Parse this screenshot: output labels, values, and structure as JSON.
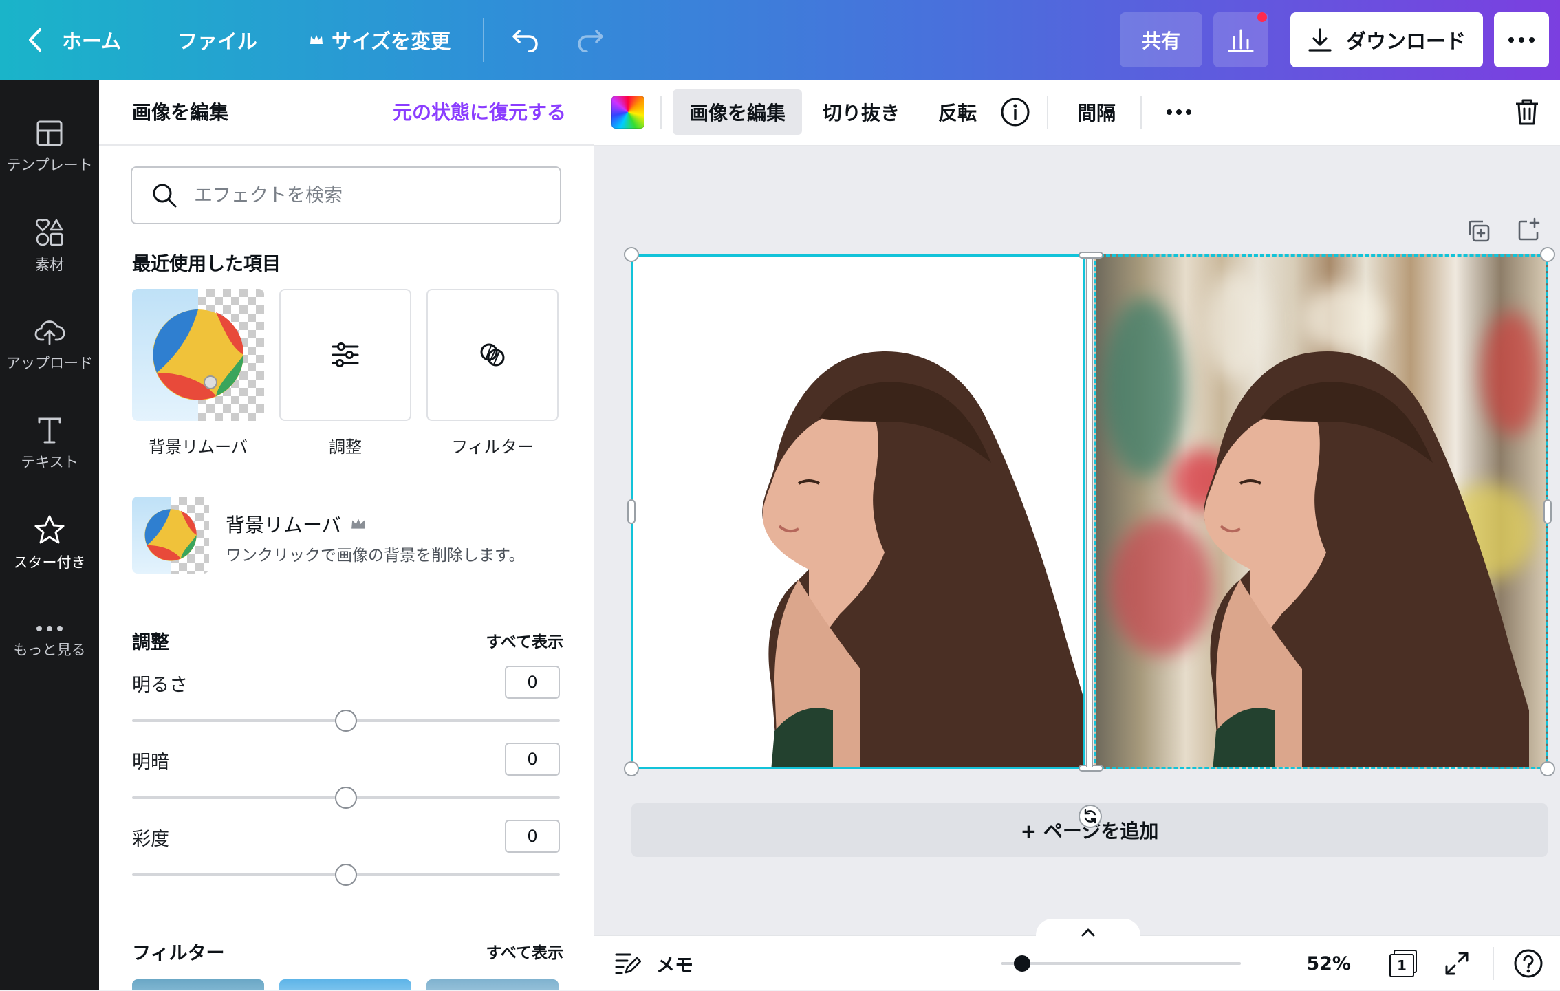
{
  "topbar": {
    "home_label": "ホーム",
    "file_label": "ファイル",
    "resize_label": "サイズを変更",
    "share_label": "共有",
    "download_label": "ダウンロード"
  },
  "rail": {
    "items": [
      {
        "label": "テンプレート",
        "icon": "template-icon"
      },
      {
        "label": "素材",
        "icon": "elements-icon"
      },
      {
        "label": "アップロード",
        "icon": "upload-icon"
      },
      {
        "label": "テキスト",
        "icon": "text-icon"
      },
      {
        "label": "スター付き",
        "icon": "star-icon"
      },
      {
        "label": "もっと見る",
        "icon": "more-icon"
      }
    ]
  },
  "panel": {
    "title": "画像を編集",
    "restore_label": "元の状態に復元する",
    "search_placeholder": "エフェクトを検索",
    "recent_heading": "最近使用した項目",
    "recent_items": [
      {
        "label": "背景リムーバ"
      },
      {
        "label": "調整"
      },
      {
        "label": "フィルター"
      }
    ],
    "promo": {
      "title": "背景リムーバ",
      "description": "ワンクリックで画像の背景を削除します。"
    },
    "adjust": {
      "heading": "調整",
      "see_all": "すべて表示",
      "sliders": [
        {
          "label": "明るさ",
          "value": "0"
        },
        {
          "label": "明暗",
          "value": "0"
        },
        {
          "label": "彩度",
          "value": "0"
        }
      ]
    },
    "filters": {
      "heading": "フィルター",
      "see_all": "すべて表示"
    }
  },
  "canvas_toolbar": {
    "edit_label": "画像を編集",
    "crop_label": "切り抜き",
    "flip_label": "反転",
    "spacing_label": "間隔"
  },
  "canvas": {
    "add_page_label": "+ ページを追加"
  },
  "bottombar": {
    "notes_label": "メモ",
    "zoom_label": "52%",
    "page_count": "1"
  },
  "colors": {
    "accent_purple": "#8b3dff",
    "selection_cyan": "#12c3d9",
    "rail_bg": "#18191b"
  }
}
